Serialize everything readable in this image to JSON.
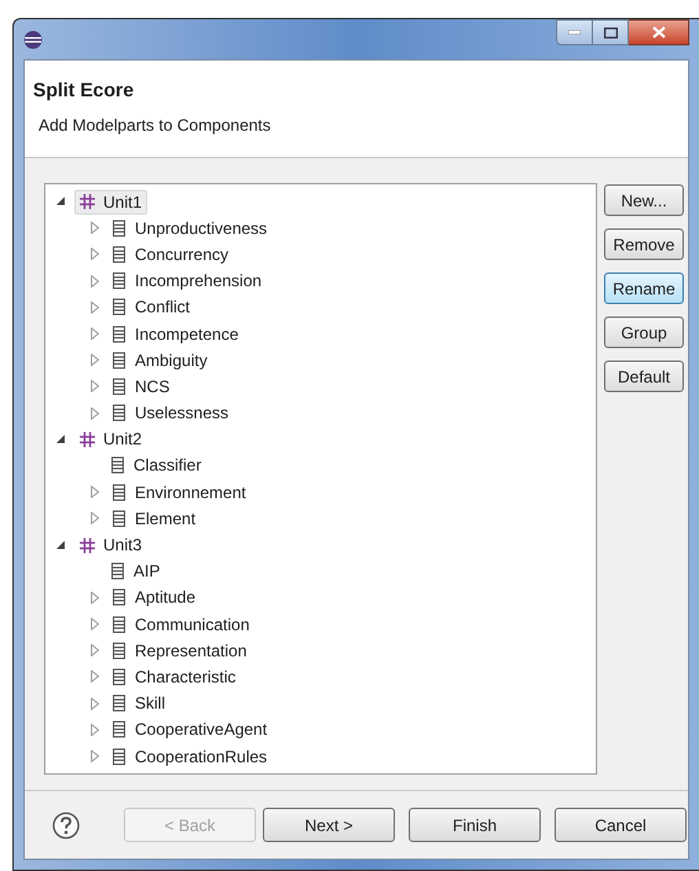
{
  "header": {
    "title": "Split Ecore",
    "subtitle": "Add Modelparts to Components"
  },
  "tree": [
    {
      "label": "Unit1",
      "expanded": true,
      "selected": true,
      "children": [
        {
          "label": "Unproductiveness",
          "expandable": true
        },
        {
          "label": "Concurrency",
          "expandable": true
        },
        {
          "label": "Incomprehension",
          "expandable": true
        },
        {
          "label": "Conflict",
          "expandable": true
        },
        {
          "label": "Incompetence",
          "expandable": true
        },
        {
          "label": "Ambiguity",
          "expandable": true
        },
        {
          "label": "NCS",
          "expandable": true
        },
        {
          "label": "Uselessness",
          "expandable": true
        }
      ]
    },
    {
      "label": "Unit2",
      "expanded": true,
      "selected": false,
      "children": [
        {
          "label": "Classifier",
          "expandable": false
        },
        {
          "label": "Environnement",
          "expandable": true
        },
        {
          "label": "Element",
          "expandable": true
        }
      ]
    },
    {
      "label": "Unit3",
      "expanded": true,
      "selected": false,
      "children": [
        {
          "label": "AIP",
          "expandable": false
        },
        {
          "label": "Aptitude",
          "expandable": true
        },
        {
          "label": "Communication",
          "expandable": true
        },
        {
          "label": "Representation",
          "expandable": true
        },
        {
          "label": "Characteristic",
          "expandable": true
        },
        {
          "label": "Skill",
          "expandable": true
        },
        {
          "label": "CooperativeAgent",
          "expandable": true
        },
        {
          "label": "CooperationRules",
          "expandable": true
        }
      ]
    }
  ],
  "side_buttons": [
    {
      "label": "New...",
      "focused": false
    },
    {
      "label": "Remove",
      "focused": false
    },
    {
      "label": "Rename",
      "focused": true
    },
    {
      "label": "Group",
      "focused": false
    },
    {
      "label": "Default",
      "focused": false
    }
  ],
  "footer_buttons": [
    {
      "label": "< Back",
      "disabled": true
    },
    {
      "label": "Next >",
      "disabled": false
    },
    {
      "label": "Finish",
      "disabled": false
    },
    {
      "label": "Cancel",
      "disabled": false
    }
  ]
}
